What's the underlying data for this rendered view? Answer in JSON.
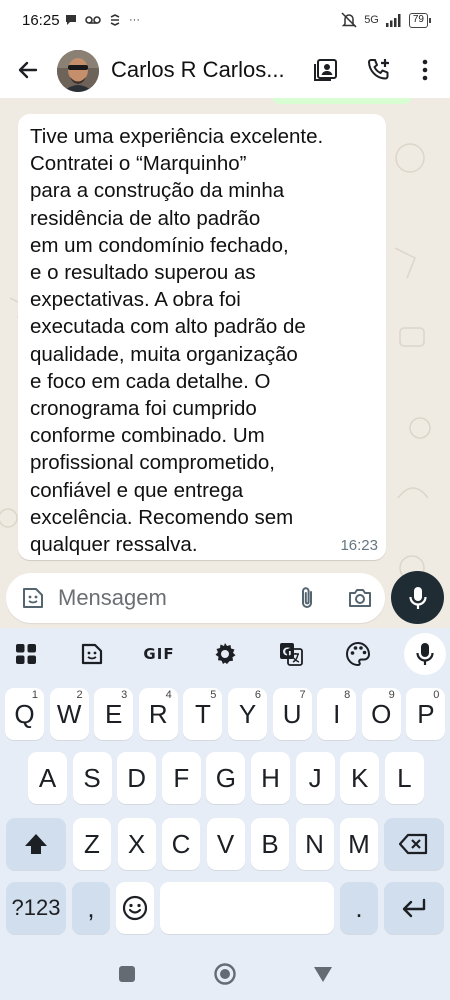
{
  "status_bar": {
    "time": "16:25",
    "more": "···",
    "network": "5G",
    "battery": "79"
  },
  "header": {
    "contact_name": "Carlos R Carlos..."
  },
  "chat": {
    "message_lines": [
      "Tive uma experiência excelente.",
      "Contratei o “Marquinho”",
      "para a construção da minha",
      "residência de alto padrão",
      "em um condomínio fechado,",
      "e o resultado superou as",
      "expectativas. A obra foi",
      "executada com alto padrão de",
      "qualidade, muita organização",
      "e foco em cada detalhe. O",
      "cronograma foi cumprido",
      "conforme combinado. Um",
      "profissional comprometido,",
      "confiável e que entrega",
      "excelência. Recomendo sem",
      "qualquer ressalva."
    ],
    "message_time": "16:23"
  },
  "input": {
    "placeholder": "Mensagem"
  },
  "keyboard": {
    "toolbar": {
      "gif_label": "GIF"
    },
    "row1": [
      {
        "key": "Q",
        "hint": "1"
      },
      {
        "key": "W",
        "hint": "2"
      },
      {
        "key": "E",
        "hint": "3"
      },
      {
        "key": "R",
        "hint": "4"
      },
      {
        "key": "T",
        "hint": "5"
      },
      {
        "key": "Y",
        "hint": "6"
      },
      {
        "key": "U",
        "hint": "7"
      },
      {
        "key": "I",
        "hint": "8"
      },
      {
        "key": "O",
        "hint": "9"
      },
      {
        "key": "P",
        "hint": "0"
      }
    ],
    "row2": [
      "A",
      "S",
      "D",
      "F",
      "G",
      "H",
      "J",
      "K",
      "L"
    ],
    "row3": [
      "Z",
      "X",
      "C",
      "V",
      "B",
      "N",
      "M"
    ],
    "bottom": {
      "symbols_label": "?123",
      "comma": ",",
      "period": "."
    }
  },
  "colors": {
    "chat_background": "#efeae2",
    "bubble_incoming": "#ffffff",
    "bubble_outgoing": "#d9fdd3",
    "keyboard_background": "#e6edf6",
    "keyboard_function_key": "#d1deed",
    "mic_button": "#1f2c34"
  },
  "icons": {
    "status_left": [
      "chat-notification-icon",
      "voicemail-icon",
      "sync-icon"
    ],
    "status_right": [
      "alarm-off-icon",
      "signal-icon",
      "battery-icon"
    ],
    "header": [
      "back-arrow-icon",
      "contact-card-icon",
      "add-call-icon",
      "more-vert-icon"
    ],
    "input": [
      "sticker-icon",
      "attach-icon",
      "camera-icon",
      "mic-icon"
    ],
    "keyboard_toolbar": [
      "apps-grid-icon",
      "sticker-icon",
      "gif-icon",
      "settings-gear-icon",
      "translate-icon",
      "palette-icon",
      "mic-icon"
    ],
    "navigation": [
      "recents-square-icon",
      "home-circle-icon",
      "back-triangle-icon"
    ]
  }
}
